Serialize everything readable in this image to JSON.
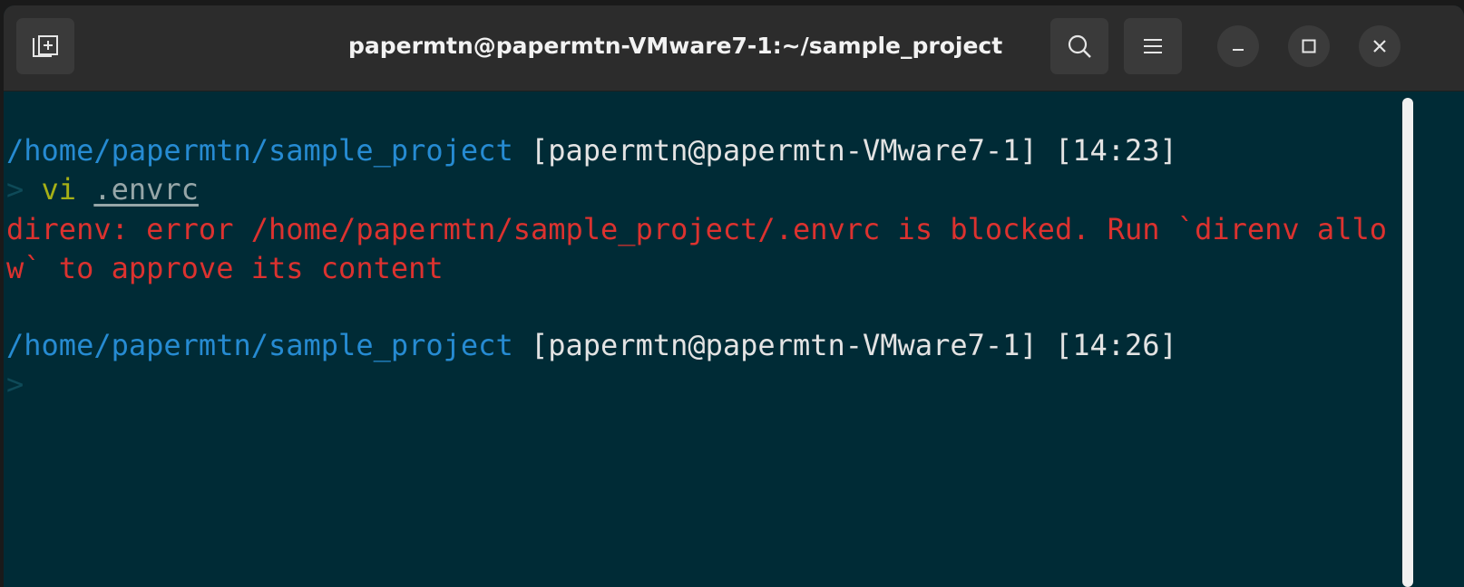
{
  "titlebar": {
    "title": "papermtn@papermtn-VMware7-1:~/sample_project",
    "new_tab_icon": "new-tab-icon",
    "search_icon": "search-icon",
    "menu_icon": "hamburger-menu-icon",
    "minimize_icon": "minimize-icon",
    "maximize_icon": "maximize-icon",
    "close_icon": "close-icon"
  },
  "terminal": {
    "background": "#002b36",
    "block1": {
      "path": "/home/papermtn/sample_project",
      "user_host": "[papermtn@papermtn-VMware7-1]",
      "time": "[14:23]",
      "prompt": ">",
      "command": "vi",
      "argument": ".envrc"
    },
    "error_line1": "direnv: error /home/papermtn/sample_project/.envrc is blocked. Run `direnv allo",
    "error_line2": "w` to approve its content",
    "block2": {
      "path": "/home/papermtn/sample_project",
      "user_host": "[papermtn@papermtn-VMware7-1]",
      "time": "[14:26]",
      "prompt": ">"
    }
  },
  "colors": {
    "path": "#268bd2",
    "error": "#dc322f",
    "command": "#a6b016",
    "titlebar": "#2c2c2c"
  }
}
